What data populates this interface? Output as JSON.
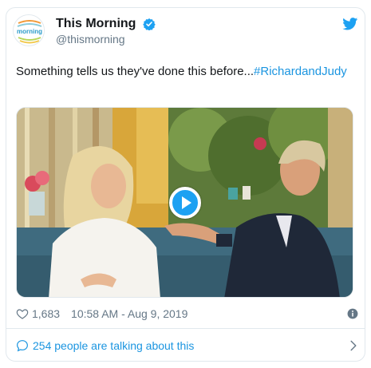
{
  "author": {
    "display_name": "This Morning",
    "handle": "@thismorning",
    "avatar_logo_text": "morning"
  },
  "tweet": {
    "text": "Something tells us they've done this before...",
    "hashtag": "#RichardandJudy"
  },
  "media": {
    "type": "video",
    "play_icon": "play-icon"
  },
  "stats": {
    "likes": "1,683",
    "timestamp": "10:58 AM - Aug 9, 2019"
  },
  "footer": {
    "conversation_label": "254 people are talking about this"
  },
  "icons": {
    "verified": "verified-badge-icon",
    "brand": "twitter-bird-icon",
    "like": "heart-icon",
    "info": "info-icon",
    "reply": "speech-bubble-icon",
    "chevron": "chevron-right-icon"
  },
  "colors": {
    "brand_blue": "#1da1f2",
    "link_blue": "#1b95e0",
    "muted": "#657786",
    "border": "#e1e8ed"
  }
}
